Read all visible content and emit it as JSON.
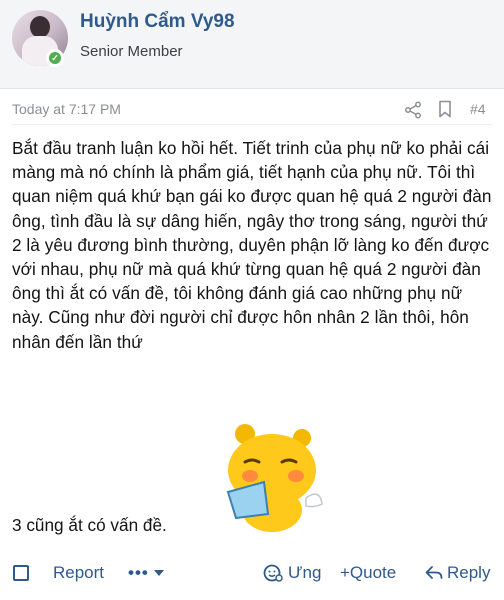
{
  "author": {
    "name": "Huỳnh Cẩm Vy98",
    "title": "Senior Member"
  },
  "post": {
    "timestamp": "Today at 7:17 PM",
    "number": "#4",
    "body": "Bắt đầu tranh luận ko hồi hết. Tiết trinh của phụ nữ ko phải cái màng mà nó chính là phẩm giá, tiết hạnh của phụ nữ. Tôi thì quan niệm quá khứ bạn gái ko được quan hệ quá 2 người đàn ông, tình đầu là sự dâng hiến, ngây thơ trong sáng, người thứ 2 là yêu đương bình thường, duyên phận lỡ làng ko đến được với nhau, phụ nữ mà quá khứ từng quan hệ quá 2 người đàn ông thì ắt có vấn đề, tôi không đánh giá cao những phụ nữ này. Cũng như đời người chỉ được hôn nhân 2 lần thôi, hôn nhân đến lần thứ",
    "tail": "3 cũng ắt có vấn đề."
  },
  "actions": {
    "report": "Report",
    "more": "•••",
    "like": "Ưng",
    "quote": "+Quote",
    "reply": "Reply"
  },
  "icons": {
    "share": "share-icon",
    "bookmark": "bookmark-icon",
    "online": "online-status-icon",
    "sticker": "emoji-sticker"
  },
  "colors": {
    "link": "#2f5a8c",
    "online": "#4fae4f",
    "header_bg": "#f4f5f7"
  }
}
